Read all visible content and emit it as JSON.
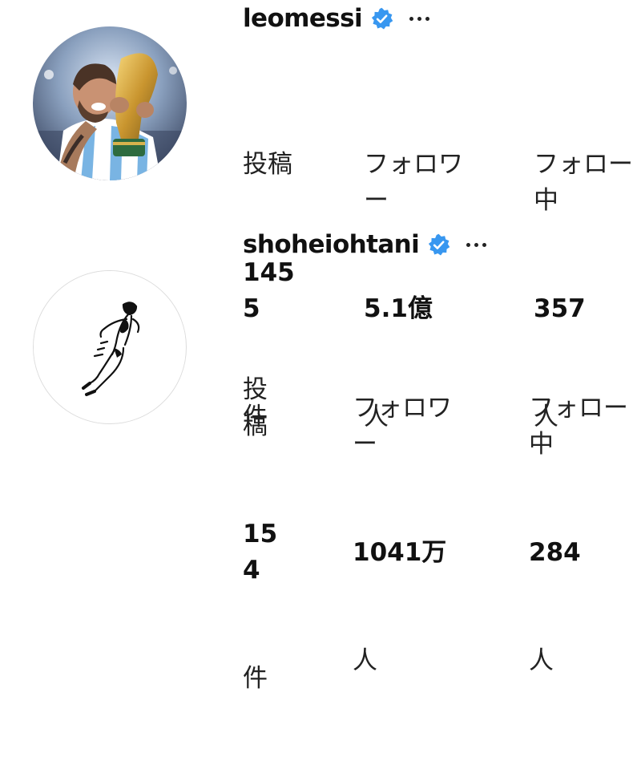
{
  "profiles": [
    {
      "username": "leomessi",
      "verified": true,
      "more_icon": "more-horizontal-icon",
      "avatar": "profile-photo",
      "stats": {
        "posts": {
          "label": "投稿",
          "value": "145\n5",
          "unit": "件"
        },
        "followers": {
          "label": "フォロワ\nー",
          "value": "5.1億",
          "unit": "人"
        },
        "following": {
          "label": "フォロー\n中",
          "value": "357",
          "unit": "人"
        }
      }
    },
    {
      "username": "shoheiohtani",
      "verified": true,
      "more_icon": "more-horizontal-icon",
      "avatar": "sketch-logo",
      "stats": {
        "posts": {
          "label": "投\n稿",
          "value": "15\n4",
          "unit": "件"
        },
        "followers": {
          "label": "フォロワ\nー",
          "value": "1041万",
          "unit": "人"
        },
        "following": {
          "label": "フォロー\n中",
          "value": "284",
          "unit": "人"
        }
      }
    }
  ],
  "colors": {
    "verified_badge": "#3897f0",
    "text": "#111111",
    "avatar_border": "#dcdcdc"
  }
}
